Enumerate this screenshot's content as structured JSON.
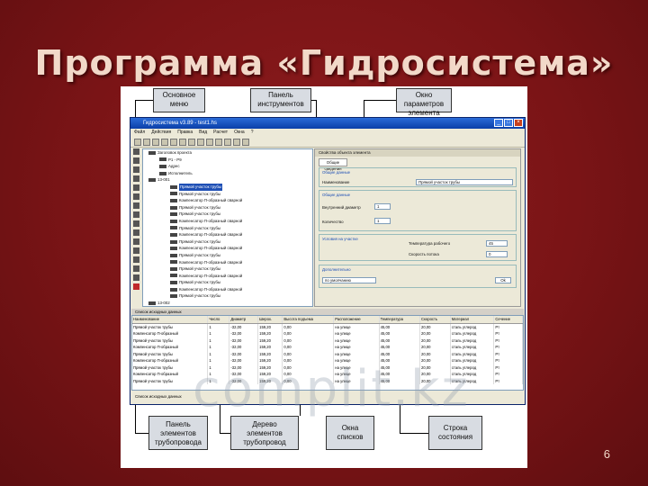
{
  "slide": {
    "title": "Программа «Гидросистема»",
    "number": "6",
    "watermark": "complit.kz"
  },
  "callouts": {
    "main_menu": "Основное меню",
    "toolbar_panel": "Панель инструментов",
    "params_window": "Окно параметров элемента",
    "elements_panel": "Панель элементов трубопровода",
    "tree": "Дерево элементов трубопровод",
    "list_windows": "Окна списков",
    "status_bar": "Строка состояния"
  },
  "app": {
    "title": "Гидросистема v3.89 - test1.hs",
    "menu": [
      "Файл",
      "Действия",
      "Правка",
      "Вид",
      "Расчет",
      "Окна",
      "?"
    ],
    "tree_items": [
      "Заголовок проекта",
      "Р1 - Р9",
      "Адрес",
      "Исполнитель",
      "13-001",
      "Прямой участок трубы",
      "Прямой участок трубы",
      "Компенсатор П-образный сварной",
      "Прямой участок трубы",
      "Прямой участок трубы",
      "Компенсатор П-образный сварной",
      "Прямой участок трубы",
      "Компенсатор П-образный сварной",
      "Прямой участок трубы",
      "Компенсатор П-образный сварной",
      "Прямой участок трубы",
      "Компенсатор П-образный сварной",
      "Прямой участок трубы",
      "Компенсатор П-образный сварной",
      "Прямой участок трубы",
      "Компенсатор П-образный сварной",
      "Прямой участок трубы",
      "13-002"
    ],
    "params": {
      "header": "Свойства объекта элемента",
      "tab": "Общие сведения",
      "group_main": "Общие данные",
      "name_label": "Наименование",
      "name_value": "Прямой участок трубы",
      "group_dims": "Общие данные",
      "inner_diam_label": "Внутренний диаметр",
      "inner_diam_value": "1",
      "length_label": "Количество",
      "length_value": "1",
      "group_flow": "Условия на участке",
      "temp_label": "Температура рабочего",
      "temp_value": "45",
      "speed_label": "Скорость потока",
      "speed_value": "0",
      "group_extra": "Дополнительно",
      "extra_value": "по умолчанию",
      "ok_label": "Ok"
    },
    "list_header": "Список исходных данных",
    "columns": [
      "Наименование",
      "Число",
      "Диаметр",
      "Шерох.",
      "Высота подъема",
      "Расположение",
      "Температура",
      "Скорость",
      "Материал",
      "Сечение"
    ],
    "rows": [
      [
        "Прямой участок трубы",
        "1",
        "-32,00",
        "159,20",
        "0,00",
        "на улице",
        "45,00",
        "20,00",
        "сталь углерод",
        "Рт"
      ],
      [
        "Компенсатор П-образный",
        "1",
        "-32,00",
        "159,20",
        "0,00",
        "на улице",
        "45,00",
        "20,00",
        "сталь углерод",
        "Рт"
      ],
      [
        "Прямой участок трубы",
        "1",
        "-32,00",
        "159,20",
        "0,00",
        "на улице",
        "45,00",
        "20,00",
        "сталь углерод",
        "Рт"
      ],
      [
        "Компенсатор П-образный",
        "1",
        "-32,00",
        "159,20",
        "0,00",
        "на улице",
        "45,00",
        "20,00",
        "сталь углерод",
        "Рт"
      ],
      [
        "Прямой участок трубы",
        "1",
        "-32,00",
        "159,20",
        "0,00",
        "на улице",
        "45,00",
        "20,00",
        "сталь углерод",
        "Рт"
      ],
      [
        "Компенсатор П-образный",
        "1",
        "-32,00",
        "159,20",
        "0,00",
        "на улице",
        "45,00",
        "20,00",
        "сталь углерод",
        "Рт"
      ],
      [
        "Прямой участок трубы",
        "1",
        "-32,00",
        "159,20",
        "0,00",
        "на улице",
        "45,00",
        "20,00",
        "сталь углерод",
        "Рт"
      ],
      [
        "Компенсатор П-образный",
        "1",
        "-32,00",
        "159,20",
        "0,00",
        "на улице",
        "45,00",
        "20,00",
        "сталь углерод",
        "Рт"
      ],
      [
        "Прямой участок трубы",
        "1",
        "-32,00",
        "159,20",
        "0,00",
        "на улице",
        "45,00",
        "20,00",
        "сталь углерод",
        "Рт"
      ]
    ],
    "status": "Список исходных данных"
  }
}
